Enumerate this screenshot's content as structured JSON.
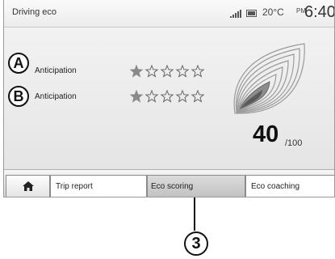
{
  "status_bar": {
    "title": "Driving eco",
    "temperature": "20°C",
    "meridiem": "PM",
    "time": "6:40",
    "icons": [
      "signal-icon",
      "battery-icon"
    ]
  },
  "ratings": [
    {
      "marker": "A",
      "label": "Anticipation",
      "stars_filled": 1,
      "stars_total": 5
    },
    {
      "marker": "B",
      "label": "Anticipation",
      "stars_filled": 1,
      "stars_total": 5
    }
  ],
  "score": {
    "value": "40",
    "max": "/100"
  },
  "tabs": {
    "home_icon": "home-icon",
    "trip_report": "Trip report",
    "eco_scoring": "Eco scoring",
    "eco_coaching": "Eco coaching",
    "selected": "eco_scoring"
  },
  "callout": {
    "number": "3"
  },
  "colors": {
    "star_empty": "#666666",
    "star_filled": "#8a8a8a",
    "leaf_line": "#9a9a9a",
    "leaf_fill": "#8c8c8c"
  }
}
